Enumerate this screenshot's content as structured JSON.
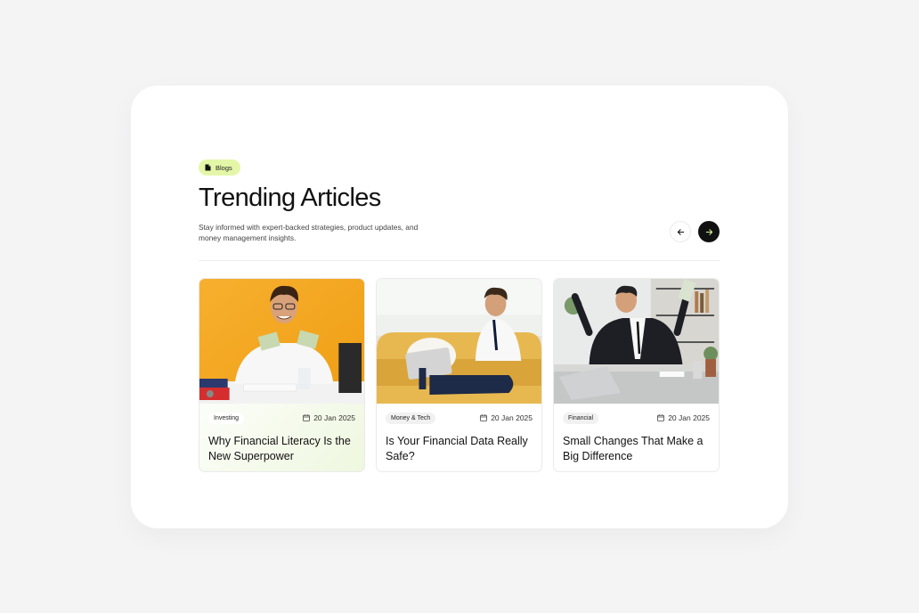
{
  "section": {
    "badge_label": "Blogs",
    "title": "Trending Articles",
    "subtitle": "Stay informed with expert-backed strategies, product updates, and money management insights."
  },
  "navigation": {
    "prev_icon": "arrow-left-icon",
    "next_icon": "arrow-right-icon"
  },
  "articles": [
    {
      "tag": "Investing",
      "date": "20 Jan 2025",
      "headline": "Why Financial Literacy Is the New Superpower",
      "image": "man holding cash at desk, orange background"
    },
    {
      "tag": "Money & Tech",
      "date": "20 Jan 2025",
      "headline": "Is Your Financial Data Really Safe?",
      "image": "man on sofa using laptop"
    },
    {
      "tag": "Financial",
      "date": "20 Jan 2025",
      "headline": "Small Changes That Make a Big Difference",
      "image": "businessman celebrating with cash in office"
    }
  ],
  "colors": {
    "badge_bg": "#e4f7a8",
    "accent_dark": "#111111",
    "next_arrow": "#d9f99d"
  }
}
